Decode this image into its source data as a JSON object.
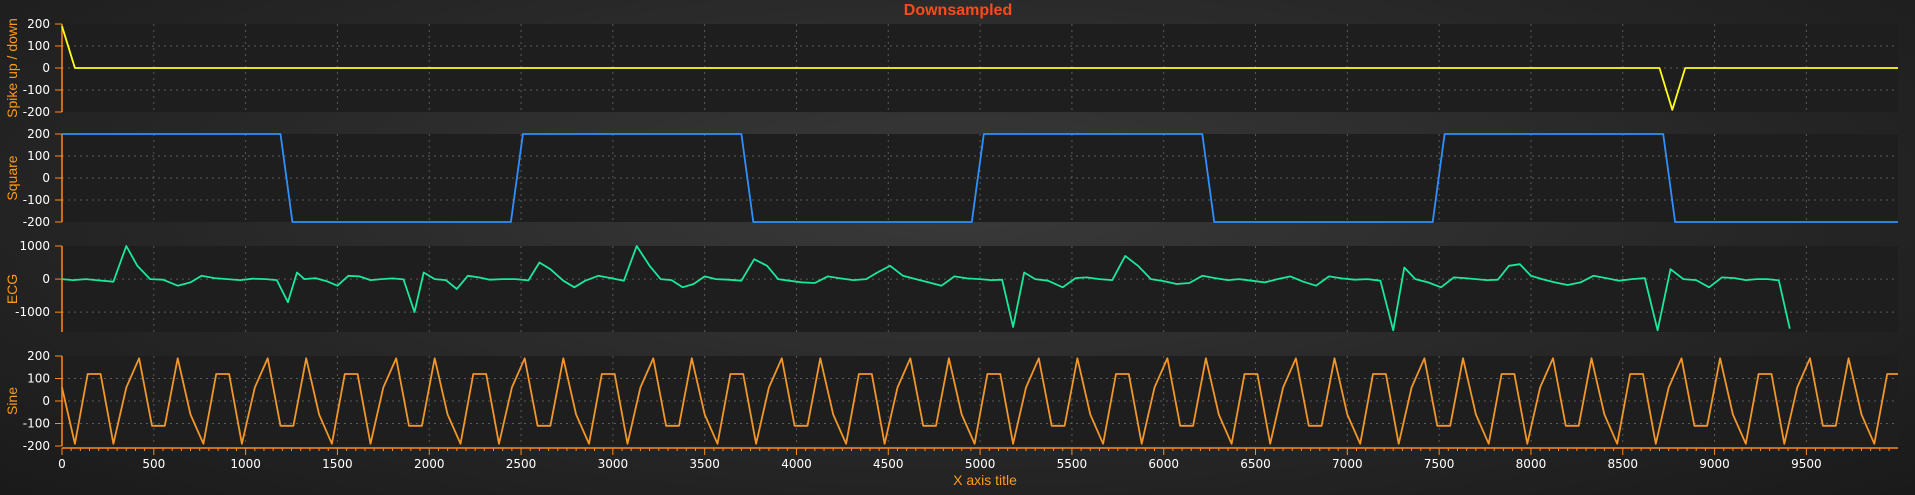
{
  "chart_data": {
    "type": "line",
    "title": "Downsampled",
    "xlabel": "X axis title",
    "xlim": [
      0,
      9999
    ],
    "xticks": [
      0,
      500,
      1000,
      1500,
      2000,
      2500,
      3000,
      3500,
      4000,
      4500,
      5000,
      5500,
      6000,
      6500,
      7000,
      7500,
      8000,
      8500,
      9000,
      9500
    ],
    "grid": true,
    "panels": [
      {
        "ylabel": "Spike up / down",
        "ylim": [
          -200,
          200
        ],
        "yticks": [
          200,
          100,
          0,
          -100,
          -200
        ],
        "color": "#ffff1a",
        "x": [
          0,
          70,
          8700,
          8770,
          8840,
          9999
        ],
        "y": [
          190,
          0,
          0,
          -190,
          0,
          0
        ]
      },
      {
        "ylabel": "Square",
        "ylim": [
          -200,
          200
        ],
        "yticks": [
          200,
          100,
          0,
          -100,
          -200
        ],
        "color": "#2f8fff",
        "x": [
          0,
          1190,
          1255,
          2445,
          2510,
          3700,
          3765,
          4955,
          5020,
          6210,
          6275,
          7465,
          7530,
          8720,
          8785,
          9999
        ],
        "y": [
          200,
          200,
          -200,
          -200,
          200,
          200,
          -200,
          -200,
          200,
          200,
          -200,
          -200,
          200,
          200,
          -200,
          -200
        ]
      },
      {
        "ylabel": "ECG",
        "ylim": [
          -1600,
          1000
        ],
        "yticks": [
          1000,
          0,
          -1000
        ],
        "color": "#1ae89a",
        "x": [
          0,
          60,
          130,
          200,
          280,
          350,
          410,
          480,
          550,
          630,
          700,
          760,
          830,
          900,
          970,
          1040,
          1110,
          1170,
          1230,
          1280,
          1320,
          1380,
          1440,
          1500,
          1560,
          1620,
          1680,
          1740,
          1800,
          1860,
          1920,
          1970,
          2030,
          2090,
          2150,
          2210,
          2270,
          2330,
          2400,
          2470,
          2540,
          2600,
          2660,
          2730,
          2790,
          2850,
          2920,
          2990,
          3060,
          3130,
          3200,
          3260,
          3320,
          3380,
          3440,
          3500,
          3560,
          3630,
          3700,
          3770,
          3840,
          3900,
          3960,
          4030,
          4100,
          4170,
          4240,
          4310,
          4380,
          4440,
          4510,
          4580,
          4650,
          4720,
          4790,
          4860,
          4930,
          5000,
          5060,
          5120,
          5180,
          5240,
          5300,
          5370,
          5450,
          5520,
          5580,
          5650,
          5720,
          5790,
          5860,
          5930,
          6000,
          6070,
          6140,
          6210,
          6280,
          6350,
          6410,
          6480,
          6550,
          6620,
          6690,
          6760,
          6830,
          6900,
          6970,
          7040,
          7110,
          7180,
          7250,
          7310,
          7370,
          7440,
          7510,
          7580,
          7640,
          7700,
          7760,
          7820,
          7880,
          7940,
          8000,
          8060,
          8130,
          8200,
          8270,
          8340,
          8410,
          8480,
          8550,
          8620,
          8690,
          8760,
          8830,
          8900,
          8970,
          9040,
          9110,
          9170,
          9230,
          9290,
          9350,
          9410,
          9480,
          9550,
          9620,
          9690,
          9760,
          9830,
          9900,
          9970
        ],
        "y": [
          0,
          -30,
          0,
          -40,
          -80,
          1000,
          400,
          0,
          -20,
          -200,
          -100,
          100,
          30,
          0,
          -30,
          10,
          0,
          -30,
          -700,
          200,
          0,
          30,
          -60,
          -200,
          100,
          80,
          -30,
          0,
          20,
          -10,
          -1000,
          200,
          0,
          -30,
          -300,
          100,
          50,
          -20,
          0,
          0,
          -40,
          500,
          300,
          -50,
          -250,
          -50,
          100,
          30,
          -50,
          1000,
          400,
          0,
          -30,
          -250,
          -150,
          80,
          0,
          -20,
          -50,
          600,
          400,
          0,
          -50,
          -100,
          -120,
          80,
          20,
          -30,
          0,
          200,
          400,
          100,
          0,
          -100,
          -200,
          80,
          20,
          0,
          -30,
          -20,
          -1450,
          200,
          0,
          -50,
          -250,
          30,
          50,
          0,
          -30,
          700,
          400,
          0,
          -60,
          -150,
          -120,
          100,
          30,
          -30,
          0,
          -50,
          -100,
          0,
          80,
          -80,
          -200,
          80,
          20,
          -20,
          0,
          -50,
          -1550,
          350,
          0,
          -100,
          -250,
          50,
          30,
          0,
          -30,
          -20,
          400,
          450,
          100,
          0,
          -100,
          -180,
          -100,
          100,
          30,
          -50,
          0,
          30,
          -1550,
          300,
          0,
          -30,
          -250,
          50,
          30,
          -30,
          0,
          0,
          -40,
          -1500
        ]
      },
      {
        "ylabel": "Sine",
        "ylim": [
          -200,
          200
        ],
        "yticks": [
          200,
          100,
          0,
          -100,
          -200
        ],
        "color": "#f0962a",
        "x": [
          0,
          70,
          140,
          210,
          280,
          350,
          420,
          490,
          560,
          630,
          700,
          770,
          840,
          910,
          980,
          1050,
          1120,
          1190,
          1260,
          1330,
          1400,
          1470,
          1540,
          1610,
          1680,
          1750,
          1820,
          1890,
          1960,
          2030,
          2100,
          2170,
          2240,
          2310,
          2380,
          2450,
          2520,
          2590,
          2660,
          2730,
          2800,
          2870,
          2940,
          3010,
          3080,
          3150,
          3220,
          3290,
          3360,
          3430,
          3500,
          3570,
          3640,
          3710,
          3780,
          3850,
          3920,
          3990,
          4060,
          4130,
          4200,
          4270,
          4340,
          4410,
          4480,
          4550,
          4620,
          4690,
          4760,
          4830,
          4900,
          4970,
          5040,
          5110,
          5180,
          5250,
          5320,
          5390,
          5460,
          5530,
          5600,
          5670,
          5740,
          5810,
          5880,
          5950,
          6020,
          6090,
          6160,
          6230,
          6300,
          6370,
          6440,
          6510,
          6580,
          6650,
          6720,
          6790,
          6860,
          6930,
          7000,
          7070,
          7140,
          7210,
          7280,
          7350,
          7420,
          7490,
          7560,
          7630,
          7700,
          7770,
          7840,
          7910,
          7980,
          8050,
          8120,
          8190,
          8260,
          8330,
          8400,
          8470,
          8540,
          8610,
          8680,
          8750,
          8820,
          8890,
          8960,
          9030,
          9100,
          9170,
          9240,
          9310,
          9380,
          9450,
          9520,
          9590,
          9660,
          9730,
          9800,
          9870,
          9940,
          9999
        ],
        "y": [
          60,
          -190,
          120,
          120,
          -190,
          60,
          190,
          -110,
          -110,
          190,
          -60,
          -190,
          120,
          120,
          -190,
          60,
          190,
          -110,
          -110,
          190,
          -60,
          -190,
          120,
          120,
          -190,
          60,
          190,
          -110,
          -110,
          190,
          -60,
          -190,
          120,
          120,
          -190,
          60,
          190,
          -110,
          -110,
          190,
          -60,
          -190,
          120,
          120,
          -190,
          60,
          190,
          -110,
          -110,
          190,
          -60,
          -190,
          120,
          120,
          -190,
          60,
          190,
          -110,
          -110,
          190,
          -60,
          -190,
          120,
          120,
          -190,
          60,
          190,
          -110,
          -110,
          190,
          -60,
          -190,
          120,
          120,
          -190,
          60,
          190,
          -110,
          -110,
          190,
          -60,
          -190,
          120,
          120,
          -190,
          60,
          190,
          -110,
          -110,
          190,
          -60,
          -190,
          120,
          120,
          -190,
          60,
          190,
          -110,
          -110,
          190,
          -60,
          -190,
          120,
          120,
          -190,
          60,
          190,
          -110,
          -110,
          190,
          -60,
          -190,
          120,
          120,
          -190,
          60,
          190,
          -110,
          -110,
          190,
          -60,
          -190,
          120,
          120,
          -190,
          60,
          190,
          -110,
          -110,
          190,
          -60,
          -190,
          120,
          120,
          -190,
          60,
          190,
          -110,
          -110,
          190,
          -60,
          -190,
          120,
          120
        ]
      }
    ]
  }
}
